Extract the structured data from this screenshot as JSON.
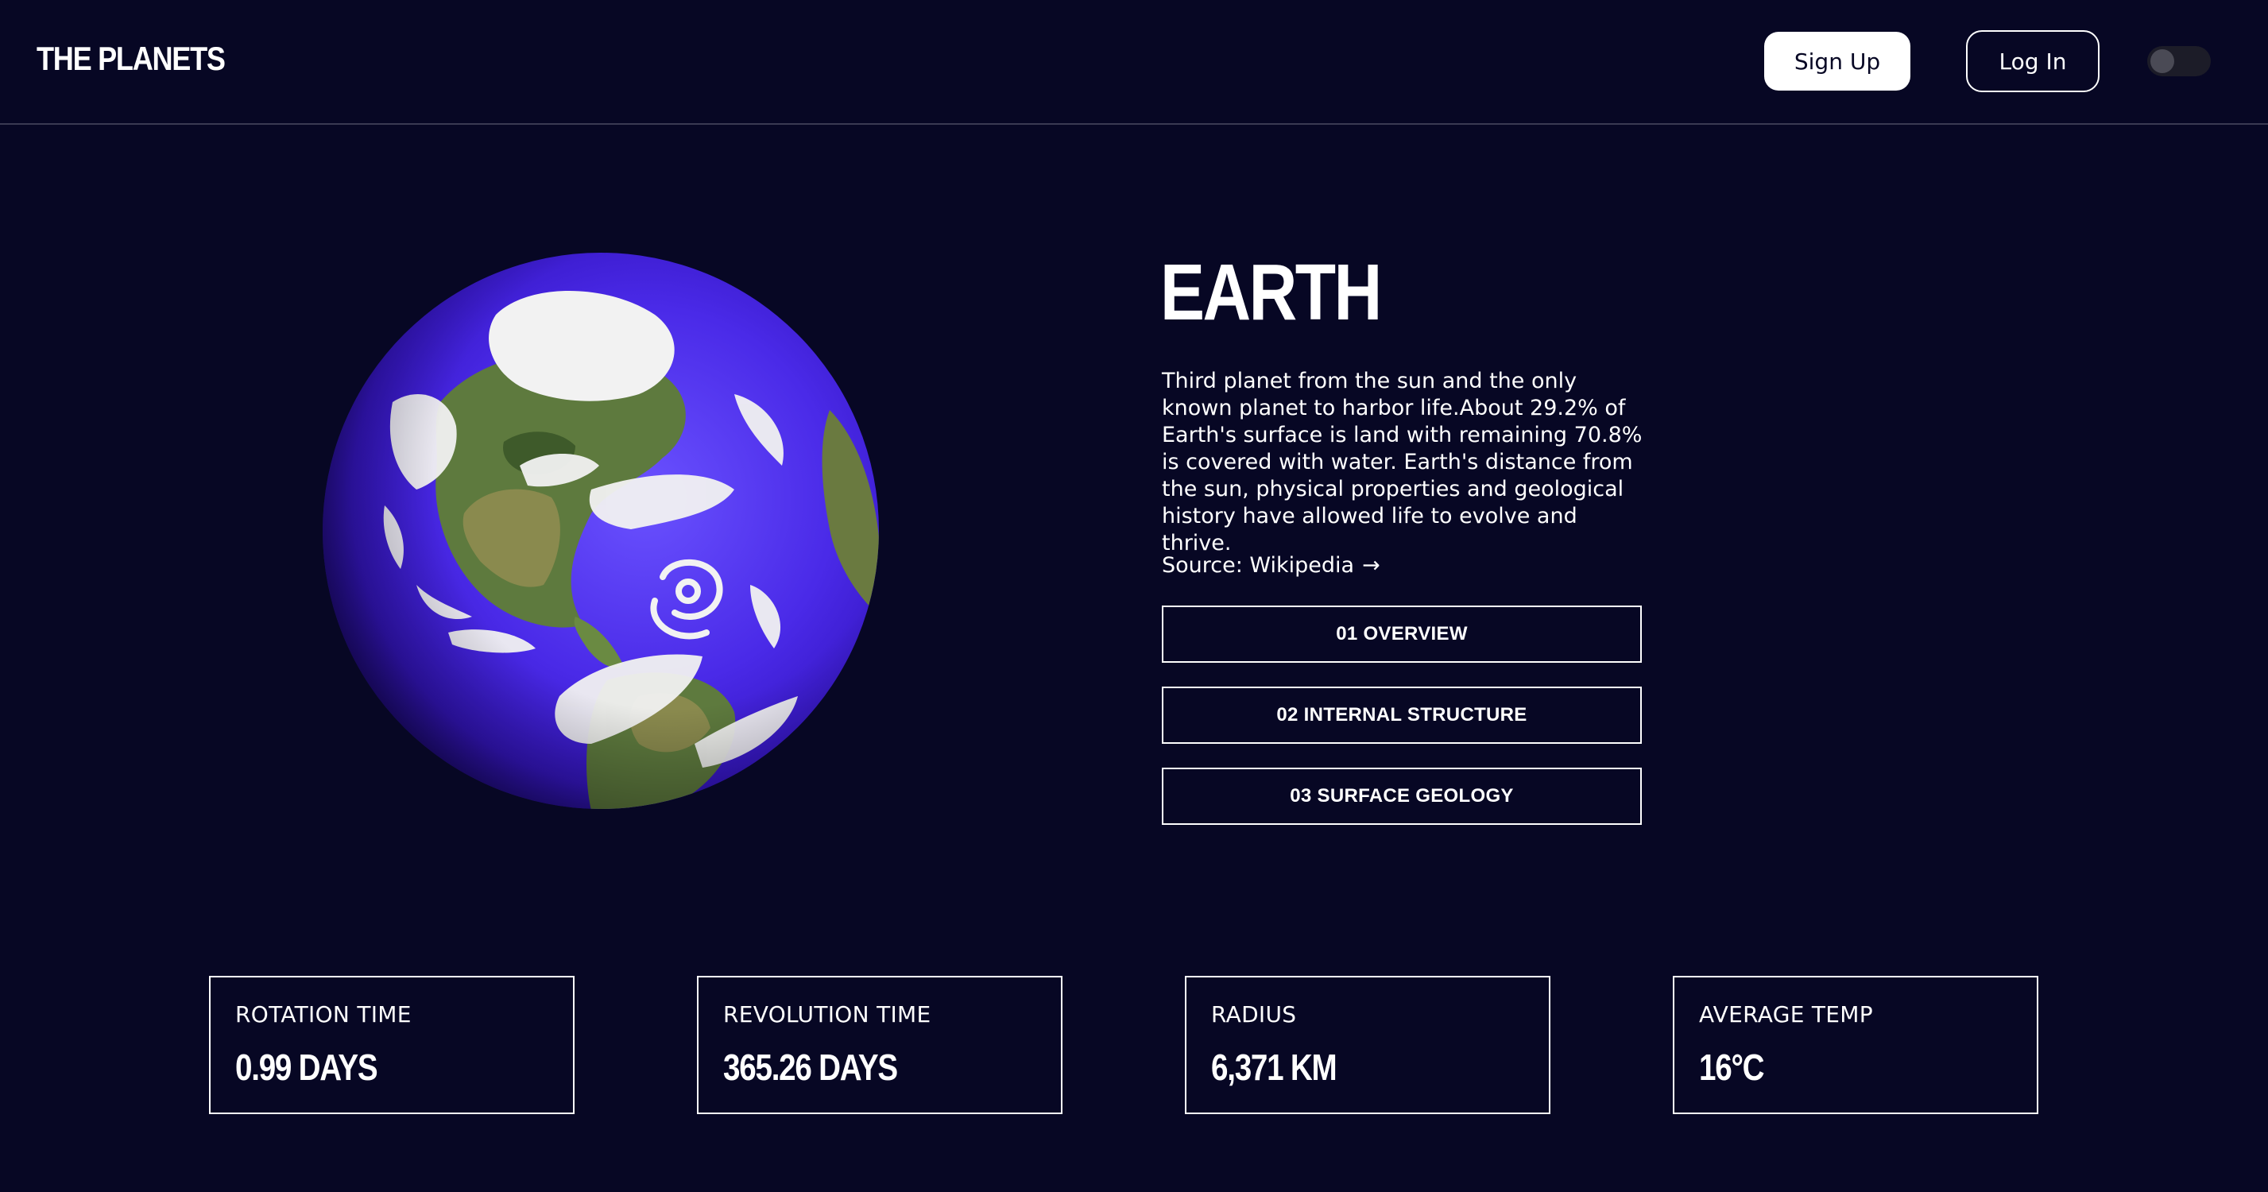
{
  "header": {
    "logo": "THE PLANETS",
    "signup_label": "Sign Up",
    "login_label": "Log In",
    "theme_toggle_on": false
  },
  "planet": {
    "name": "EARTH",
    "description": "Third planet from the sun and the only known planet to harbor life.About 29.2% of Earth's surface is land with remaining 70.8% is covered with water. Earth's distance from the sun, physical properties and geological history have allowed life to evolve and thrive.",
    "source_prefix": "Source: ",
    "source_link": "Wikipedia",
    "source_arrow": "→"
  },
  "tabs": [
    {
      "label": "01 OVERVIEW"
    },
    {
      "label": "02 INTERNAL STRUCTURE"
    },
    {
      "label": "03 SURFACE GEOLOGY"
    }
  ],
  "stats": [
    {
      "label": "ROTATION TIME",
      "value": "0.99 DAYS"
    },
    {
      "label": "REVOLUTION TIME",
      "value": "365.26 DAYS"
    },
    {
      "label": "RADIUS",
      "value": "6,371 KM"
    },
    {
      "label": "AVERAGE TEMP",
      "value": "16°C"
    }
  ],
  "colors": {
    "background": "#070724",
    "ocean": "#4a2ae8",
    "land": "#5e7a3e",
    "cloud": "#f2f2f2"
  }
}
